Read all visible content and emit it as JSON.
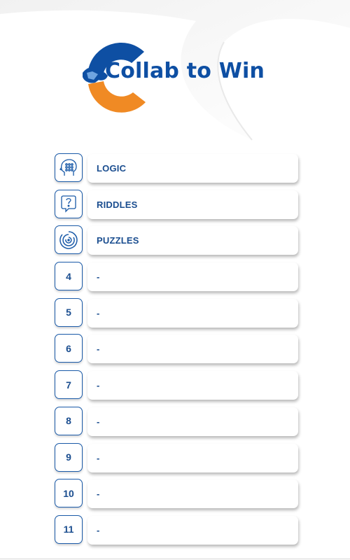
{
  "app": {
    "title": "Collab to Win",
    "colors": {
      "primary": "#0e4fa3",
      "accent": "#f08a24",
      "text": "#1a4d8f"
    }
  },
  "menu": {
    "items": [
      {
        "icon": "head-gears-icon",
        "label": "LOGIC"
      },
      {
        "icon": "question-bubble-icon",
        "label": "RIDDLES"
      },
      {
        "icon": "maze-icon",
        "label": "PUZZLES"
      },
      {
        "number": "4",
        "label": "-"
      },
      {
        "number": "5",
        "label": "-"
      },
      {
        "number": "6",
        "label": "-"
      },
      {
        "number": "7",
        "label": "-"
      },
      {
        "number": "8",
        "label": "-"
      },
      {
        "number": "9",
        "label": "-"
      },
      {
        "number": "10",
        "label": "-"
      },
      {
        "number": "11",
        "label": "-"
      }
    ]
  }
}
